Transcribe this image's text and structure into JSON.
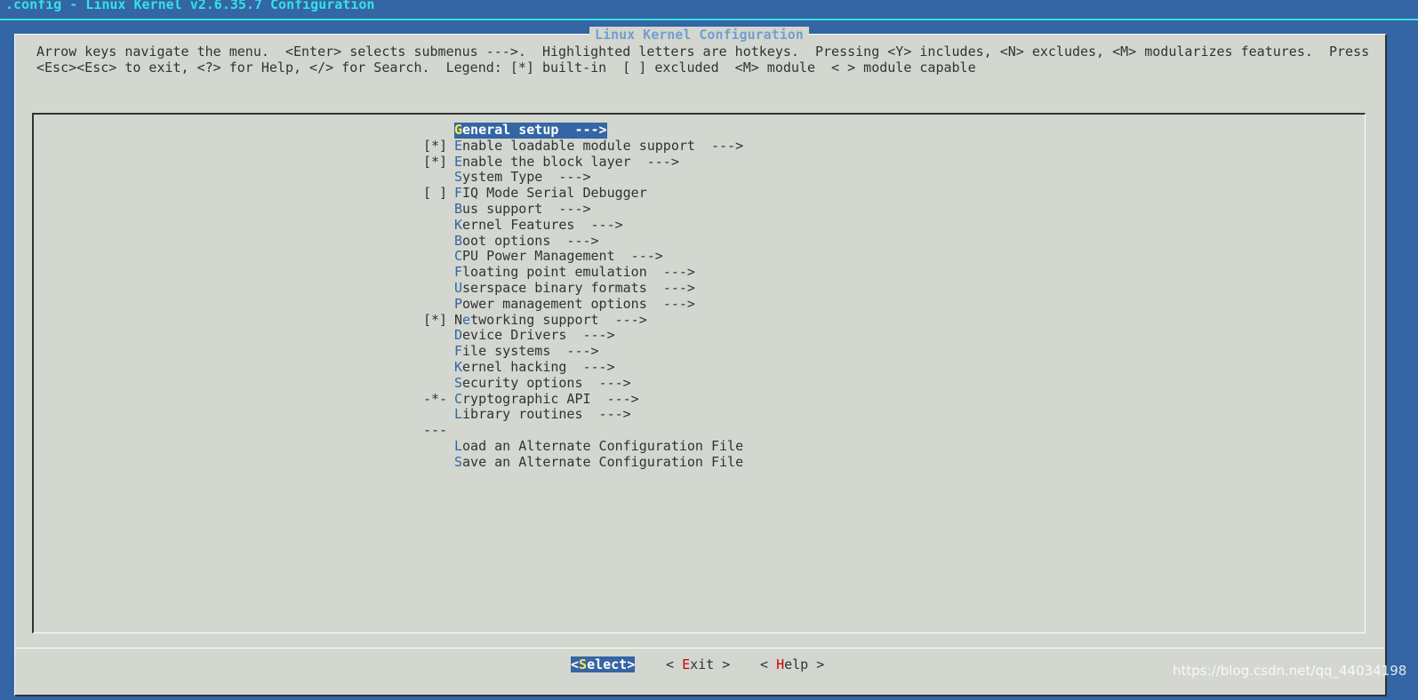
{
  "window": {
    "title": ".config - Linux Kernel v2.6.35.7 Configuration"
  },
  "dialog": {
    "title": "Linux Kernel Configuration",
    "help_line1": "Arrow keys navigate the menu.  <Enter> selects submenus --->.  Highlighted letters are hotkeys.  Pressing <Y> includes, <N> excludes, <M> modularizes features.  Press",
    "help_line2": "<Esc><Esc> to exit, <?> for Help, </> for Search.  Legend: [*] built-in  [ ] excluded  <M> module  < > module capable"
  },
  "menu": {
    "items": [
      {
        "prefix": "",
        "hot": "G",
        "rest": "eneral setup  --->",
        "selected": true
      },
      {
        "prefix": "[*]",
        "hot": "E",
        "rest": "nable loadable module support  --->"
      },
      {
        "prefix": "[*]",
        "hot": "E",
        "rest": "nable the block layer  --->"
      },
      {
        "prefix": "",
        "hot": "S",
        "rest": "ystem Type  --->"
      },
      {
        "prefix": "[ ]",
        "hot": "F",
        "rest": "IQ Mode Serial Debugger"
      },
      {
        "prefix": "",
        "hot": "B",
        "rest": "us support  --->"
      },
      {
        "prefix": "",
        "hot": "K",
        "rest": "ernel Features  --->"
      },
      {
        "prefix": "",
        "hot": "B",
        "rest": "oot options  --->"
      },
      {
        "prefix": "",
        "hot": "C",
        "rest": "PU Power Management  --->"
      },
      {
        "prefix": "",
        "hot": "F",
        "rest": "loating point emulation  --->"
      },
      {
        "prefix": "",
        "hot": "U",
        "rest": "serspace binary formats  --->"
      },
      {
        "prefix": "",
        "hot": "P",
        "rest": "ower management options  --->"
      },
      {
        "prefix": "[*]",
        "pre": "N",
        "hot": "e",
        "rest": "tworking support  --->"
      },
      {
        "prefix": "",
        "hot": "D",
        "rest": "evice Drivers  --->"
      },
      {
        "prefix": "",
        "hot": "F",
        "rest": "ile systems  --->"
      },
      {
        "prefix": "",
        "hot": "K",
        "rest": "ernel hacking  --->"
      },
      {
        "prefix": "",
        "hot": "S",
        "rest": "ecurity options  --->"
      },
      {
        "prefix": "-*-",
        "hot": "C",
        "rest": "ryptographic API  --->"
      },
      {
        "prefix": "",
        "hot": "L",
        "rest": "ibrary routines  --->"
      },
      {
        "prefix": "---",
        "hot": "",
        "rest": ""
      },
      {
        "prefix": "",
        "hot": "L",
        "rest": "oad an Alternate Configuration File"
      },
      {
        "prefix": "",
        "hot": "S",
        "rest": "ave an Alternate Configuration File"
      }
    ]
  },
  "buttons": {
    "select": {
      "pre": "<",
      "hot": "S",
      "rest": "elect>"
    },
    "exit": {
      "pre": "< ",
      "hot": "E",
      "rest": "xit >"
    },
    "help": {
      "pre": "< ",
      "hot": "H",
      "rest": "elp >"
    }
  },
  "watermark": "https://blog.csdn.net/qq_44034198",
  "colors": {
    "background": "#3465a4",
    "dialog": "#d3d7cf",
    "highlight": "#3465a4",
    "hotkey": "#3465a4",
    "title": "#34e2e2"
  }
}
